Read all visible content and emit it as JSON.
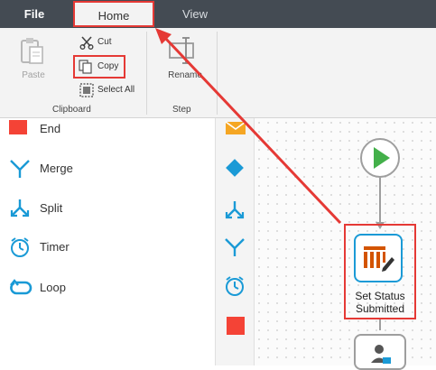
{
  "menu": {
    "file": "File",
    "home": "Home",
    "view": "View"
  },
  "ribbon": {
    "paste": "Paste",
    "cut": "Cut",
    "copy": "Copy",
    "select_all": "Select All",
    "rename": "Rename",
    "group_clipboard": "Clipboard",
    "group_step": "Step"
  },
  "palette": {
    "items": [
      {
        "label": "End",
        "icon": "end-square-icon"
      },
      {
        "label": "Merge",
        "icon": "merge-icon"
      },
      {
        "label": "Split",
        "icon": "split-icon"
      },
      {
        "label": "Timer",
        "icon": "timer-icon"
      },
      {
        "label": "Loop",
        "icon": "loop-icon"
      }
    ]
  },
  "canvas": {
    "node_label_line1": "Set Status",
    "node_label_line2": "Submitted"
  },
  "colors": {
    "menubar": "#444b53",
    "highlight": "#e53935",
    "accent_blue": "#1a9ad6",
    "start_green": "#43b04a",
    "end_red": "#f44336",
    "node_orange": "#d35400"
  }
}
